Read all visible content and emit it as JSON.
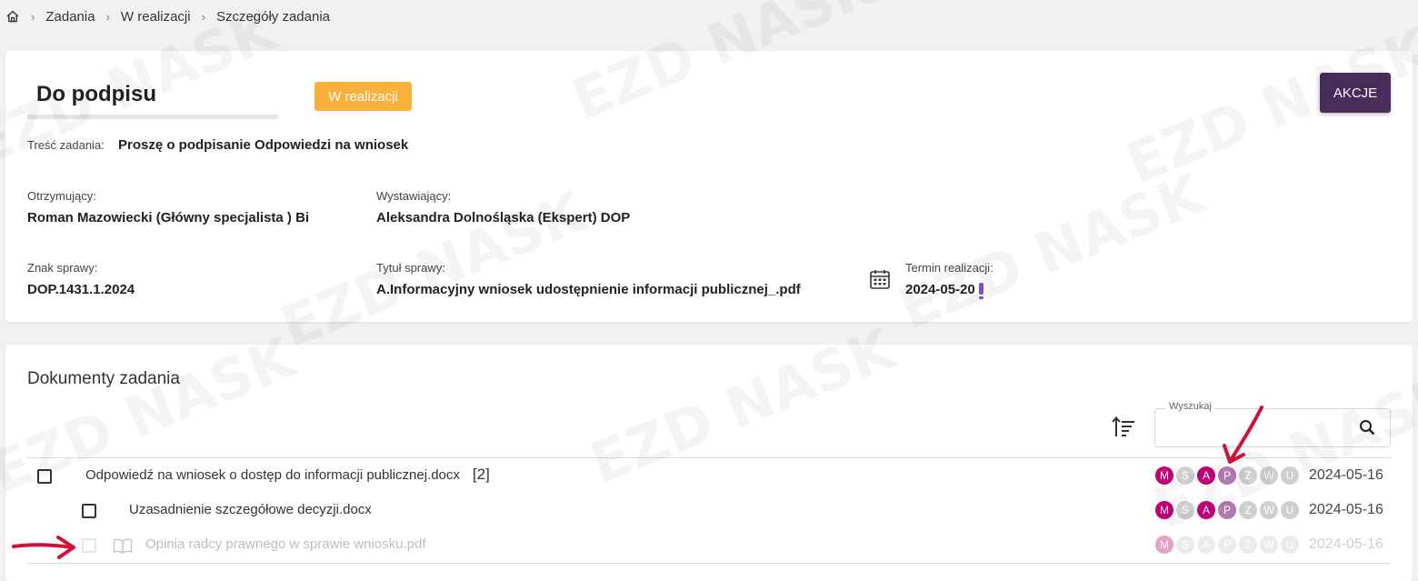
{
  "breadcrumb": {
    "items": [
      "Zadania",
      "W realizacji",
      "Szczegóły zadania"
    ]
  },
  "task": {
    "title": "Do podpisu",
    "status": "W realizacji",
    "actions_label": "AKCJE",
    "content_label": "Treść zadania:",
    "content_value": "Proszę o podpisanie Odpowiedzi na wniosek",
    "recipient_label": "Otrzymujący:",
    "recipient_value": "Roman Mazowiecki (Główny specjalista ) Bi",
    "issuer_label": "Wystawiający:",
    "issuer_value": "Aleksandra Dolnośląska (Ekspert) DOP",
    "case_sign_label": "Znak sprawy:",
    "case_sign_value": "DOP.1431.1.2024",
    "case_title_label": "Tytuł sprawy:",
    "case_title_value": "A.Informacyjny wniosek udostępnienie informacji publicznej_.pdf",
    "deadline_label": "Termin realizacji:",
    "deadline_value": "2024-05-20"
  },
  "documents": {
    "section_title": "Dokumenty zadania",
    "search_label": "Wyszukaj",
    "search_value": "",
    "rows": [
      {
        "name": "Odpowiedź na wniosek o dostęp do informacji publicznej.docx",
        "count": "[2]",
        "date": "2024-05-16",
        "badges": [
          {
            "letter": "M",
            "color": "#c2007a"
          },
          {
            "letter": "S",
            "color": "#cfcfcf"
          },
          {
            "letter": "A",
            "color": "#c2007a"
          },
          {
            "letter": "P",
            "color": "#b07ab0"
          },
          {
            "letter": "Z",
            "color": "#cfcfcf"
          },
          {
            "letter": "W",
            "color": "#cfcfcf"
          },
          {
            "letter": "U",
            "color": "#cfcfcf"
          }
        ]
      },
      {
        "name": "Uzasadnienie szczegółowe decyzji.docx",
        "count": "",
        "date": "2024-05-16",
        "badges": [
          {
            "letter": "M",
            "color": "#c2007a"
          },
          {
            "letter": "S",
            "color": "#cfcfcf"
          },
          {
            "letter": "A",
            "color": "#c2007a"
          },
          {
            "letter": "P",
            "color": "#b07ab0"
          },
          {
            "letter": "Z",
            "color": "#cfcfcf"
          },
          {
            "letter": "W",
            "color": "#cfcfcf"
          },
          {
            "letter": "U",
            "color": "#cfcfcf"
          }
        ]
      },
      {
        "name": "Opinia radcy prawnego w sprawie wniosku.pdf",
        "count": "",
        "date": "2024-05-16",
        "badges": [
          {
            "letter": "M",
            "color": "#e6a0c8"
          },
          {
            "letter": "S",
            "color": "#ebebeb"
          },
          {
            "letter": "A",
            "color": "#ebebeb"
          },
          {
            "letter": "P",
            "color": "#ebebeb"
          },
          {
            "letter": "Z",
            "color": "#ebebeb"
          },
          {
            "letter": "W",
            "color": "#ebebeb"
          },
          {
            "letter": "U",
            "color": "#ebebeb"
          }
        ]
      }
    ]
  },
  "colors": {
    "accent": "#4b2d5b",
    "status_badge": "#f9b13c",
    "priority_mark": "#7a4fd8",
    "annotation_arrow": "#d0103a"
  },
  "icons": [
    "home-icon",
    "calendar-icon",
    "sort-icon",
    "search-icon",
    "book-icon"
  ]
}
